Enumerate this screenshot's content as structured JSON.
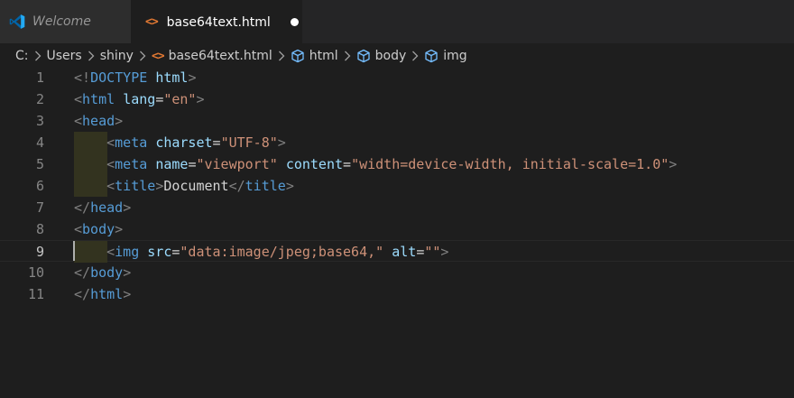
{
  "tabs": [
    {
      "label": "Welcome",
      "icon": "vscode-logo-icon",
      "active": false
    },
    {
      "label": "base64text.html",
      "icon": "html-file-icon",
      "active": true,
      "modified": true
    }
  ],
  "breadcrumb": {
    "items": [
      "C:",
      "Users",
      "shiny",
      "base64text.html",
      "html",
      "body",
      "img"
    ]
  },
  "editor": {
    "current_line": 9,
    "lines": [
      {
        "number": "1",
        "tokens": [
          [
            "t-pun",
            "<!"
          ],
          [
            "t-tag",
            "DOCTYPE"
          ],
          [
            "t-txt",
            " "
          ],
          [
            "t-att",
            "html"
          ],
          [
            "t-pun",
            ">"
          ]
        ]
      },
      {
        "number": "2",
        "tokens": [
          [
            "t-pun",
            "<"
          ],
          [
            "t-tag",
            "html"
          ],
          [
            "t-txt",
            " "
          ],
          [
            "t-att",
            "lang"
          ],
          [
            "t-txt",
            "="
          ],
          [
            "t-str",
            "\"en\""
          ],
          [
            "t-pun",
            ">"
          ]
        ]
      },
      {
        "number": "3",
        "tokens": [
          [
            "t-pun",
            "<"
          ],
          [
            "t-tag",
            "head"
          ],
          [
            "t-pun",
            ">"
          ]
        ]
      },
      {
        "number": "4",
        "indent": true,
        "tokens": [
          [
            "t-txt",
            "    "
          ],
          [
            "t-pun",
            "<"
          ],
          [
            "t-tag",
            "meta"
          ],
          [
            "t-txt",
            " "
          ],
          [
            "t-att",
            "charset"
          ],
          [
            "t-txt",
            "="
          ],
          [
            "t-str",
            "\"UTF-8\""
          ],
          [
            "t-pun",
            ">"
          ]
        ]
      },
      {
        "number": "5",
        "indent": true,
        "tokens": [
          [
            "t-txt",
            "    "
          ],
          [
            "t-pun",
            "<"
          ],
          [
            "t-tag",
            "meta"
          ],
          [
            "t-txt",
            " "
          ],
          [
            "t-att",
            "name"
          ],
          [
            "t-txt",
            "="
          ],
          [
            "t-str",
            "\"viewport\""
          ],
          [
            "t-txt",
            " "
          ],
          [
            "t-att",
            "content"
          ],
          [
            "t-txt",
            "="
          ],
          [
            "t-str",
            "\"width=device-width, initial-scale=1.0\""
          ],
          [
            "t-pun",
            ">"
          ]
        ]
      },
      {
        "number": "6",
        "indent": true,
        "tokens": [
          [
            "t-txt",
            "    "
          ],
          [
            "t-pun",
            "<"
          ],
          [
            "t-tag",
            "title"
          ],
          [
            "t-pun",
            ">"
          ],
          [
            "t-txt",
            "Document"
          ],
          [
            "t-pun",
            "</"
          ],
          [
            "t-tag",
            "title"
          ],
          [
            "t-pun",
            ">"
          ]
        ]
      },
      {
        "number": "7",
        "tokens": [
          [
            "t-pun",
            "</"
          ],
          [
            "t-tag",
            "head"
          ],
          [
            "t-pun",
            ">"
          ]
        ]
      },
      {
        "number": "8",
        "tokens": [
          [
            "t-pun",
            "<"
          ],
          [
            "t-tag",
            "body"
          ],
          [
            "t-pun",
            ">"
          ]
        ]
      },
      {
        "number": "9",
        "indent": true,
        "tokens": [
          [
            "t-txt",
            "    "
          ],
          [
            "t-pun",
            "<"
          ],
          [
            "t-tag",
            "img"
          ],
          [
            "t-txt",
            " "
          ],
          [
            "t-att",
            "src"
          ],
          [
            "t-txt",
            "="
          ],
          [
            "t-str",
            "\"data:image/jpeg;base64,\""
          ],
          [
            "t-txt",
            " "
          ],
          [
            "t-att",
            "alt"
          ],
          [
            "t-txt",
            "="
          ],
          [
            "t-str",
            "\"\""
          ],
          [
            "t-pun",
            ">"
          ]
        ]
      },
      {
        "number": "10",
        "tokens": [
          [
            "t-pun",
            "</"
          ],
          [
            "t-tag",
            "body"
          ],
          [
            "t-pun",
            ">"
          ]
        ]
      },
      {
        "number": "11",
        "tokens": [
          [
            "t-pun",
            "</"
          ],
          [
            "t-tag",
            "html"
          ],
          [
            "t-pun",
            ">"
          ]
        ]
      }
    ]
  },
  "colors": {
    "background": "#1e1e1e",
    "tab_bar": "#252526",
    "tag": "#569cd6",
    "attribute": "#9cdcfe",
    "string": "#ce9178",
    "punctuation": "#808080",
    "html_icon": "#e37933",
    "vscode_logo": "#23a9f2"
  }
}
